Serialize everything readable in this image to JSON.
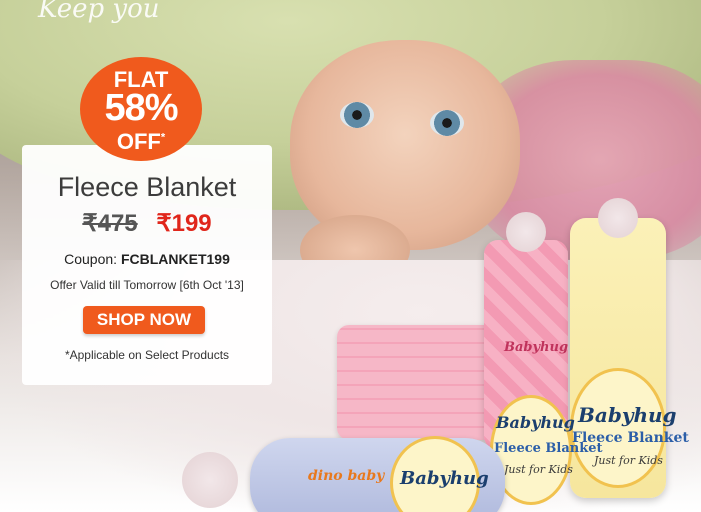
{
  "banner": {
    "script_text": "Keep you",
    "badge": {
      "flat": "FLAT",
      "percent": "58%",
      "off": "OFF",
      "asterisk": "*"
    },
    "card": {
      "title": "Fleece Blanket",
      "old_price": "₹475",
      "new_price": "₹199",
      "coupon_label": "Coupon:",
      "coupon_code": "FCBLANKET199",
      "validity": "Offer Valid till Tomorrow [6th Oct '13]",
      "shop_button": "SHOP NOW",
      "disclaimer": "*Applicable on Select Products"
    },
    "products": {
      "brand": "Babyhug",
      "product_name": "Fleece Blanket",
      "tagline": "Just for Kids",
      "blue_roll_text": "dino baby"
    }
  }
}
